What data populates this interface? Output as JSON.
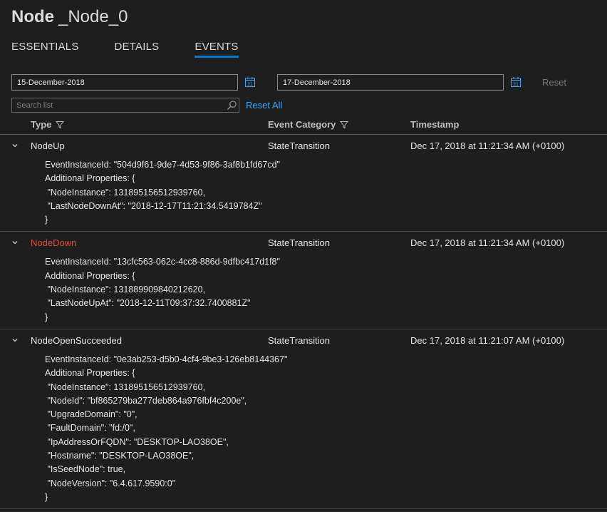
{
  "title": {
    "bold": "Node",
    "name": "_Node_0"
  },
  "tabs": [
    {
      "label": "ESSENTIALS",
      "active": false
    },
    {
      "label": "DETAILS",
      "active": false
    },
    {
      "label": "EVENTS",
      "active": true
    }
  ],
  "filters": {
    "start_date": "15-December-2018",
    "end_date": "17-December-2018",
    "reset_label": "Reset",
    "search_placeholder": "Search list",
    "reset_all_label": "Reset All"
  },
  "columns": {
    "type": "Type",
    "category": "Event Category",
    "timestamp": "Timestamp"
  },
  "events": [
    {
      "type": "NodeUp",
      "category": "StateTransition",
      "timestamp": "Dec 17, 2018 at 11:21:34 AM (+0100)",
      "details": [
        "EventInstanceId: \"504d9f61-9de7-4d53-9f86-3af8b1fd67cd\"",
        "Additional Properties: {",
        " \"NodeInstance\": 131895156512939760,",
        " \"LastNodeDownAt\": \"2018-12-17T11:21:34.5419784Z\"",
        "}"
      ]
    },
    {
      "type": "NodeDown",
      "category": "StateTransition",
      "timestamp": "Dec 17, 2018 at 11:21:34 AM (+0100)",
      "details": [
        "EventInstanceId: \"13cfc563-062c-4cc8-886d-9dfbc417d1f8\"",
        "Additional Properties: {",
        " \"NodeInstance\": 131889909840212620,",
        " \"LastNodeUpAt\": \"2018-12-11T09:37:32.7400881Z\"",
        "}"
      ]
    },
    {
      "type": "NodeOpenSucceeded",
      "category": "StateTransition",
      "timestamp": "Dec 17, 2018 at 11:21:07 AM (+0100)",
      "details": [
        "EventInstanceId: \"0e3ab253-d5b0-4cf4-9be3-126eb8144367\"",
        "Additional Properties: {",
        " \"NodeInstance\": 131895156512939760,",
        " \"NodeId\": \"bf865279ba277deb864a976fbf4c200e\",",
        " \"UpgradeDomain\": \"0\",",
        " \"FaultDomain\": \"fd:/0\",",
        " \"IpAddressOrFQDN\": \"DESKTOP-LAO38OE\",",
        " \"Hostname\": \"DESKTOP-LAO38OE\",",
        " \"IsSeedNode\": true,",
        " \"NodeVersion\": \"6.4.617.9590:0\"",
        "}"
      ]
    }
  ]
}
